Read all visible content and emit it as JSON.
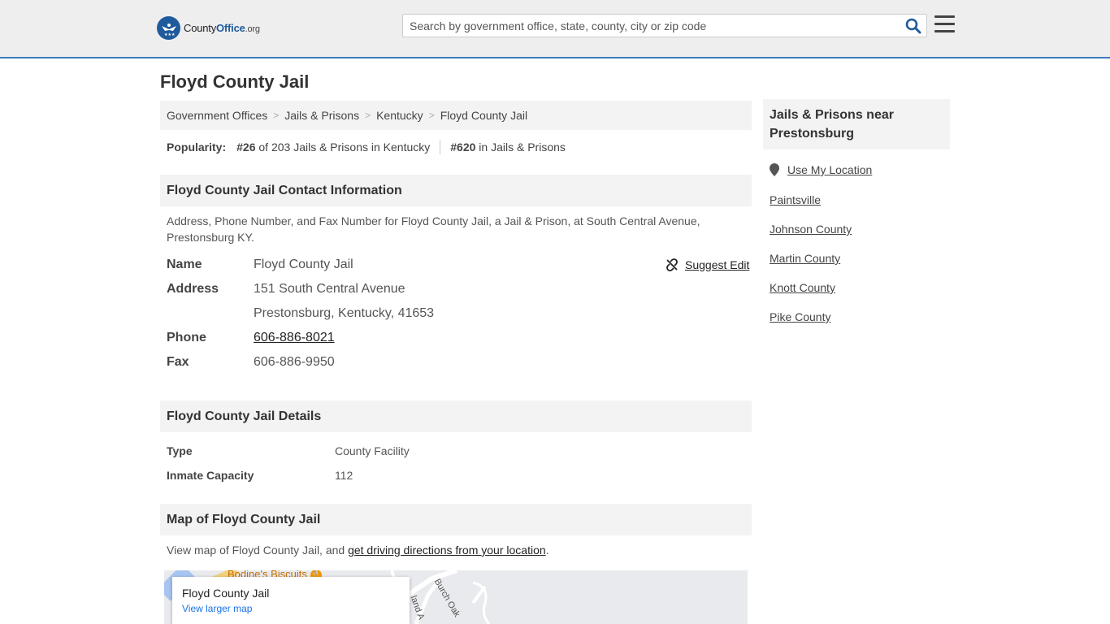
{
  "header": {
    "logo_main": "County",
    "logo_bold": "Office",
    "logo_tld": ".org",
    "search_placeholder": "Search by government office, state, county, city or zip code",
    "brand_color": "#1f5b9c"
  },
  "page": {
    "title": "Floyd County Jail"
  },
  "breadcrumb": [
    "Government Offices",
    "Jails & Prisons",
    "Kentucky",
    "Floyd County Jail"
  ],
  "popularity": {
    "label": "Popularity:",
    "state_rank": "#26",
    "state_text": " of 203 Jails & Prisons in Kentucky",
    "national_rank": "#620",
    "national_text": " in Jails & Prisons"
  },
  "contact": {
    "heading": "Floyd County Jail Contact Information",
    "intro_line1": "Address, Phone Number, and Fax Number for Floyd County Jail, a Jail & Prison, at South Central Avenue,",
    "intro_line2": "Prestonsburg KY.",
    "suggest_edit": "Suggest Edit",
    "name_label": "Name",
    "name_value": "Floyd County Jail",
    "address_label": "Address",
    "address_line1": "151 South Central Avenue",
    "address_line2": "Prestonsburg, Kentucky, 41653",
    "phone_label": "Phone",
    "phone_value": "606-886-8021",
    "fax_label": "Fax",
    "fax_value": "606-886-9950"
  },
  "details": {
    "heading": "Floyd County Jail Details",
    "type_label": "Type",
    "type_value": "County Facility",
    "capacity_label": "Inmate Capacity",
    "capacity_value": "112"
  },
  "map": {
    "heading": "Map of Floyd County Jail",
    "text_before": "View map of Floyd County Jail, and ",
    "link_text": "get driving directions from your location",
    "text_after": ".",
    "card_title": "Floyd County Jail",
    "card_link": "View larger map",
    "poi_label": "Bodine's Biscuits",
    "street_1": "Burch Oak",
    "street_2": "land A"
  },
  "sidebar": {
    "heading": "Jails & Prisons near Prestonsburg",
    "use_location": "Use My Location",
    "links": [
      "Paintsville",
      "Johnson County",
      "Martin County",
      "Knott County",
      "Pike County"
    ]
  }
}
